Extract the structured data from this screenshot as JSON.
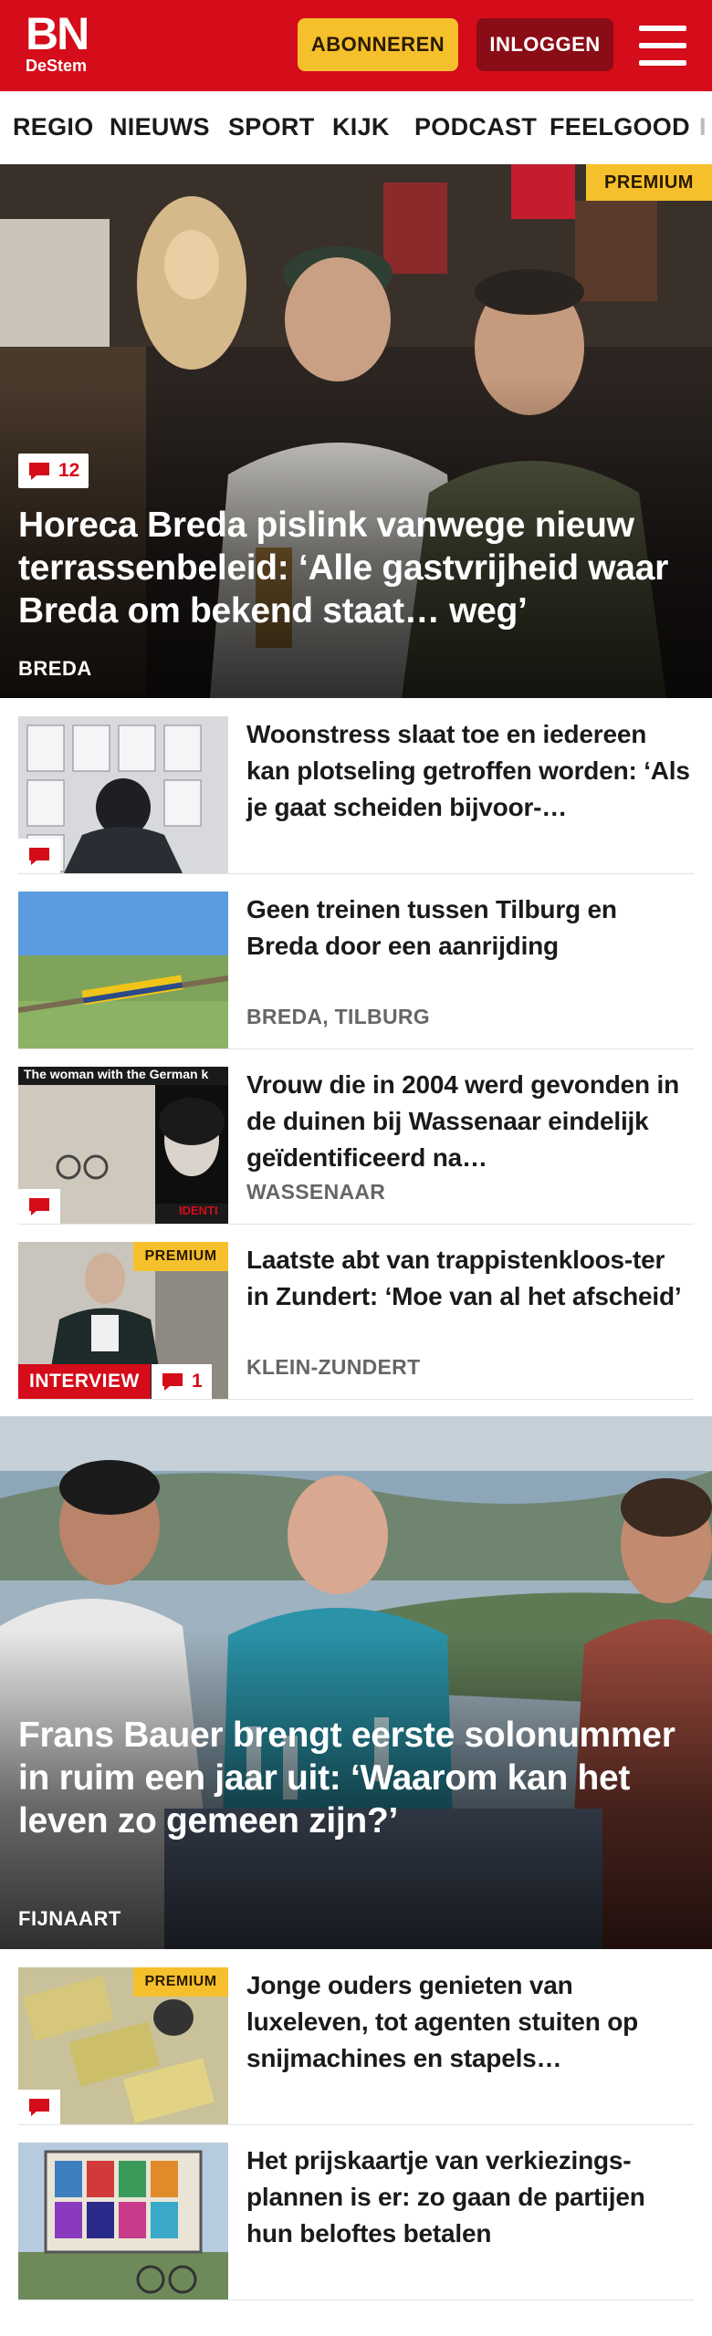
{
  "header": {
    "logo_main": "BN",
    "logo_sub": "DeStem",
    "subscribe_label": "ABONNEREN",
    "login_label": "INLOGGEN",
    "menu_icon": "hamburger-menu-icon"
  },
  "nav": {
    "items": [
      "REGIO",
      "NIEUWS",
      "SPORT",
      "KIJK",
      "PODCAST",
      "FEELGOOD"
    ]
  },
  "hero1": {
    "premium": "PREMIUM",
    "comments": "12",
    "title": "Horeca Breda pislink vanwege nieuw terrassenbeleid: ‘Alle gastvrijheid waar Breda om bekend staat… weg’",
    "location": "BREDA"
  },
  "articles": [
    {
      "title": "Woonstress slaat toe en iedereen kan plotseling getroffen worden: ‘Als je gaat scheiden bijvoor-…",
      "location": ""
    },
    {
      "title": "Geen treinen tussen Tilburg en Breda door een aanrijding",
      "location": "BREDA, TILBURG"
    },
    {
      "title": "Vrouw die in 2004 werd gevonden in de duinen bij Wassenaar eindelijk geïdentificeerd na…",
      "location": "WASSENAAR",
      "thumb_caption": "The woman with the German k",
      "thumb_caption2": "IDENTI"
    },
    {
      "title": "Laatste abt van trappistenkloos-ter in Zundert: ‘Moe van al het afscheid’",
      "location": "KLEIN-ZUNDERT",
      "premium": "PREMIUM",
      "interview": "INTERVIEW",
      "comments": "1"
    }
  ],
  "hero2": {
    "title": "Frans Bauer brengt eerste solonummer in ruim een jaar uit: ‘Waarom kan het leven zo gemeen zijn?’",
    "location": "FIJNAART"
  },
  "articles2": [
    {
      "title": "Jonge ouders genieten van luxeleven, tot agenten stuiten op snijmachines en stapels…",
      "premium": "PREMIUM"
    },
    {
      "title": "Het prijskaartje van verkiezings-plannen is er: zo gaan de partijen hun beloftes betalen"
    }
  ],
  "colors": {
    "brand_red": "#d50c1a",
    "premium_yellow": "#f5c02c",
    "login_dark_red": "#8a0c16"
  }
}
